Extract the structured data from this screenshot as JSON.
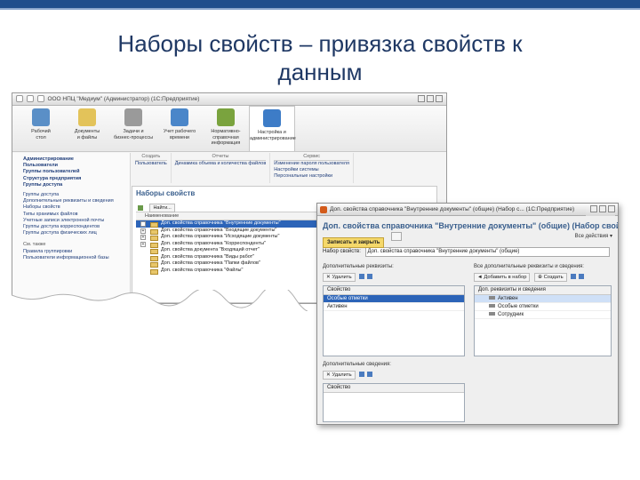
{
  "slide": {
    "title_line1": "Наборы свойств – привязка свойств к",
    "title_line2": "данным"
  },
  "app_window": {
    "title": "ООО НПЦ \"Медиум\" (Администратор) (1С:Предприятие)",
    "sections": [
      {
        "label1": "Рабочий",
        "label2": "стол",
        "icon": "desk-icon",
        "color": "#5a8fc7"
      },
      {
        "label1": "Документы",
        "label2": "и файлы",
        "icon": "documents-icon",
        "color": "#e3c35a"
      },
      {
        "label1": "Задачи и",
        "label2": "бизнес-процессы",
        "icon": "tasks-icon",
        "color": "#9a9a9a"
      },
      {
        "label1": "Учет рабочего",
        "label2": "времени",
        "icon": "clock-icon",
        "color": "#4a86c9"
      },
      {
        "label1": "Нормативно-справочная",
        "label2": "информация",
        "icon": "books-icon",
        "color": "#7aa33e"
      },
      {
        "label1": "Настройка и",
        "label2": "администрирование",
        "icon": "settings-icon",
        "color": "#3d7cc7"
      }
    ],
    "sidebar": {
      "bold_items": [
        "Администрирование",
        "Пользователи",
        "Группы пользователей",
        "Структура предприятия",
        "Группы доступа"
      ],
      "items": [
        "Группы доступа",
        "Дополнительные реквизиты и сведения",
        "Наборы свойств",
        "Типы хранимых файлов",
        "Учетные записи электронной почты",
        "Группы доступа корреспондентов",
        "Группы доступа физических лиц"
      ],
      "see_also_heading": "См. также",
      "see_also": [
        "Правила группировки",
        "Пользователи информационной базы"
      ]
    },
    "functions": [
      {
        "heading": "Создать",
        "items": [
          "Пользователь"
        ]
      },
      {
        "heading": "Отчеты",
        "items": [
          "Динамика объема и количества файлов"
        ]
      },
      {
        "heading": "Сервис",
        "items": [
          "Изменение пароля пользователя",
          "Настройки системы",
          "Персональные настройки"
        ]
      }
    ],
    "list": {
      "heading": "Наборы свойств",
      "find_button": "Найти...",
      "column_header": "Наименование",
      "rows": [
        {
          "name": "Доп. свойства справочника \"Внутренние документы\"",
          "selected": true,
          "expand": "+"
        },
        {
          "name": "Доп. свойства справочника \"Входящие документы\"",
          "selected": false,
          "expand": "+"
        },
        {
          "name": "Доп. свойства справочника \"Исходящие документы\"",
          "selected": false,
          "expand": "+"
        },
        {
          "name": "Доп. свойства справочника \"Корреспонденты\"",
          "selected": false,
          "expand": "+"
        },
        {
          "name": "Доп. свойства документа \"Входящий отчет\"",
          "selected": false,
          "expand": ""
        },
        {
          "name": "Доп. свойства справочника \"Виды работ\"",
          "selected": false,
          "expand": ""
        },
        {
          "name": "Доп. свойства справочника \"Папки файлов\"",
          "selected": false,
          "expand": ""
        },
        {
          "name": "Доп. свойства справочника \"Файлы\"",
          "selected": false,
          "expand": ""
        }
      ]
    }
  },
  "dialog": {
    "title": "Доп. свойства справочника \"Внутренние документы\" (общие) (Набор с... (1С:Предприятие)",
    "heading": "Доп. свойства справочника \"Внутренние документы\" (общие) (Набор свойст...",
    "save_close": "Записать и закрыть",
    "more_actions": "Все действия ▾",
    "name_label": "Набор свойств:",
    "name_value": "Доп. свойства справочника \"Внутренние документы\" (общие)",
    "left_caption": "Дополнительные реквизиты:",
    "right_caption": "Все дополнительные реквизиты и сведения:",
    "delete_label": "Удалить",
    "add_label": "Добавить в набор",
    "create_label": "Создать",
    "property_col": "Свойство",
    "right_col": "Доп. реквизиты и сведения",
    "left_rows": [
      "Свойство",
      "Особые отметки",
      "Активен"
    ],
    "right_rows": [
      "Доп. реквизиты и сведения",
      "Активен",
      "Особые отметки",
      "Сотрудник"
    ],
    "lower_caption": "Дополнительные сведения:",
    "lower_col": "Свойство"
  }
}
